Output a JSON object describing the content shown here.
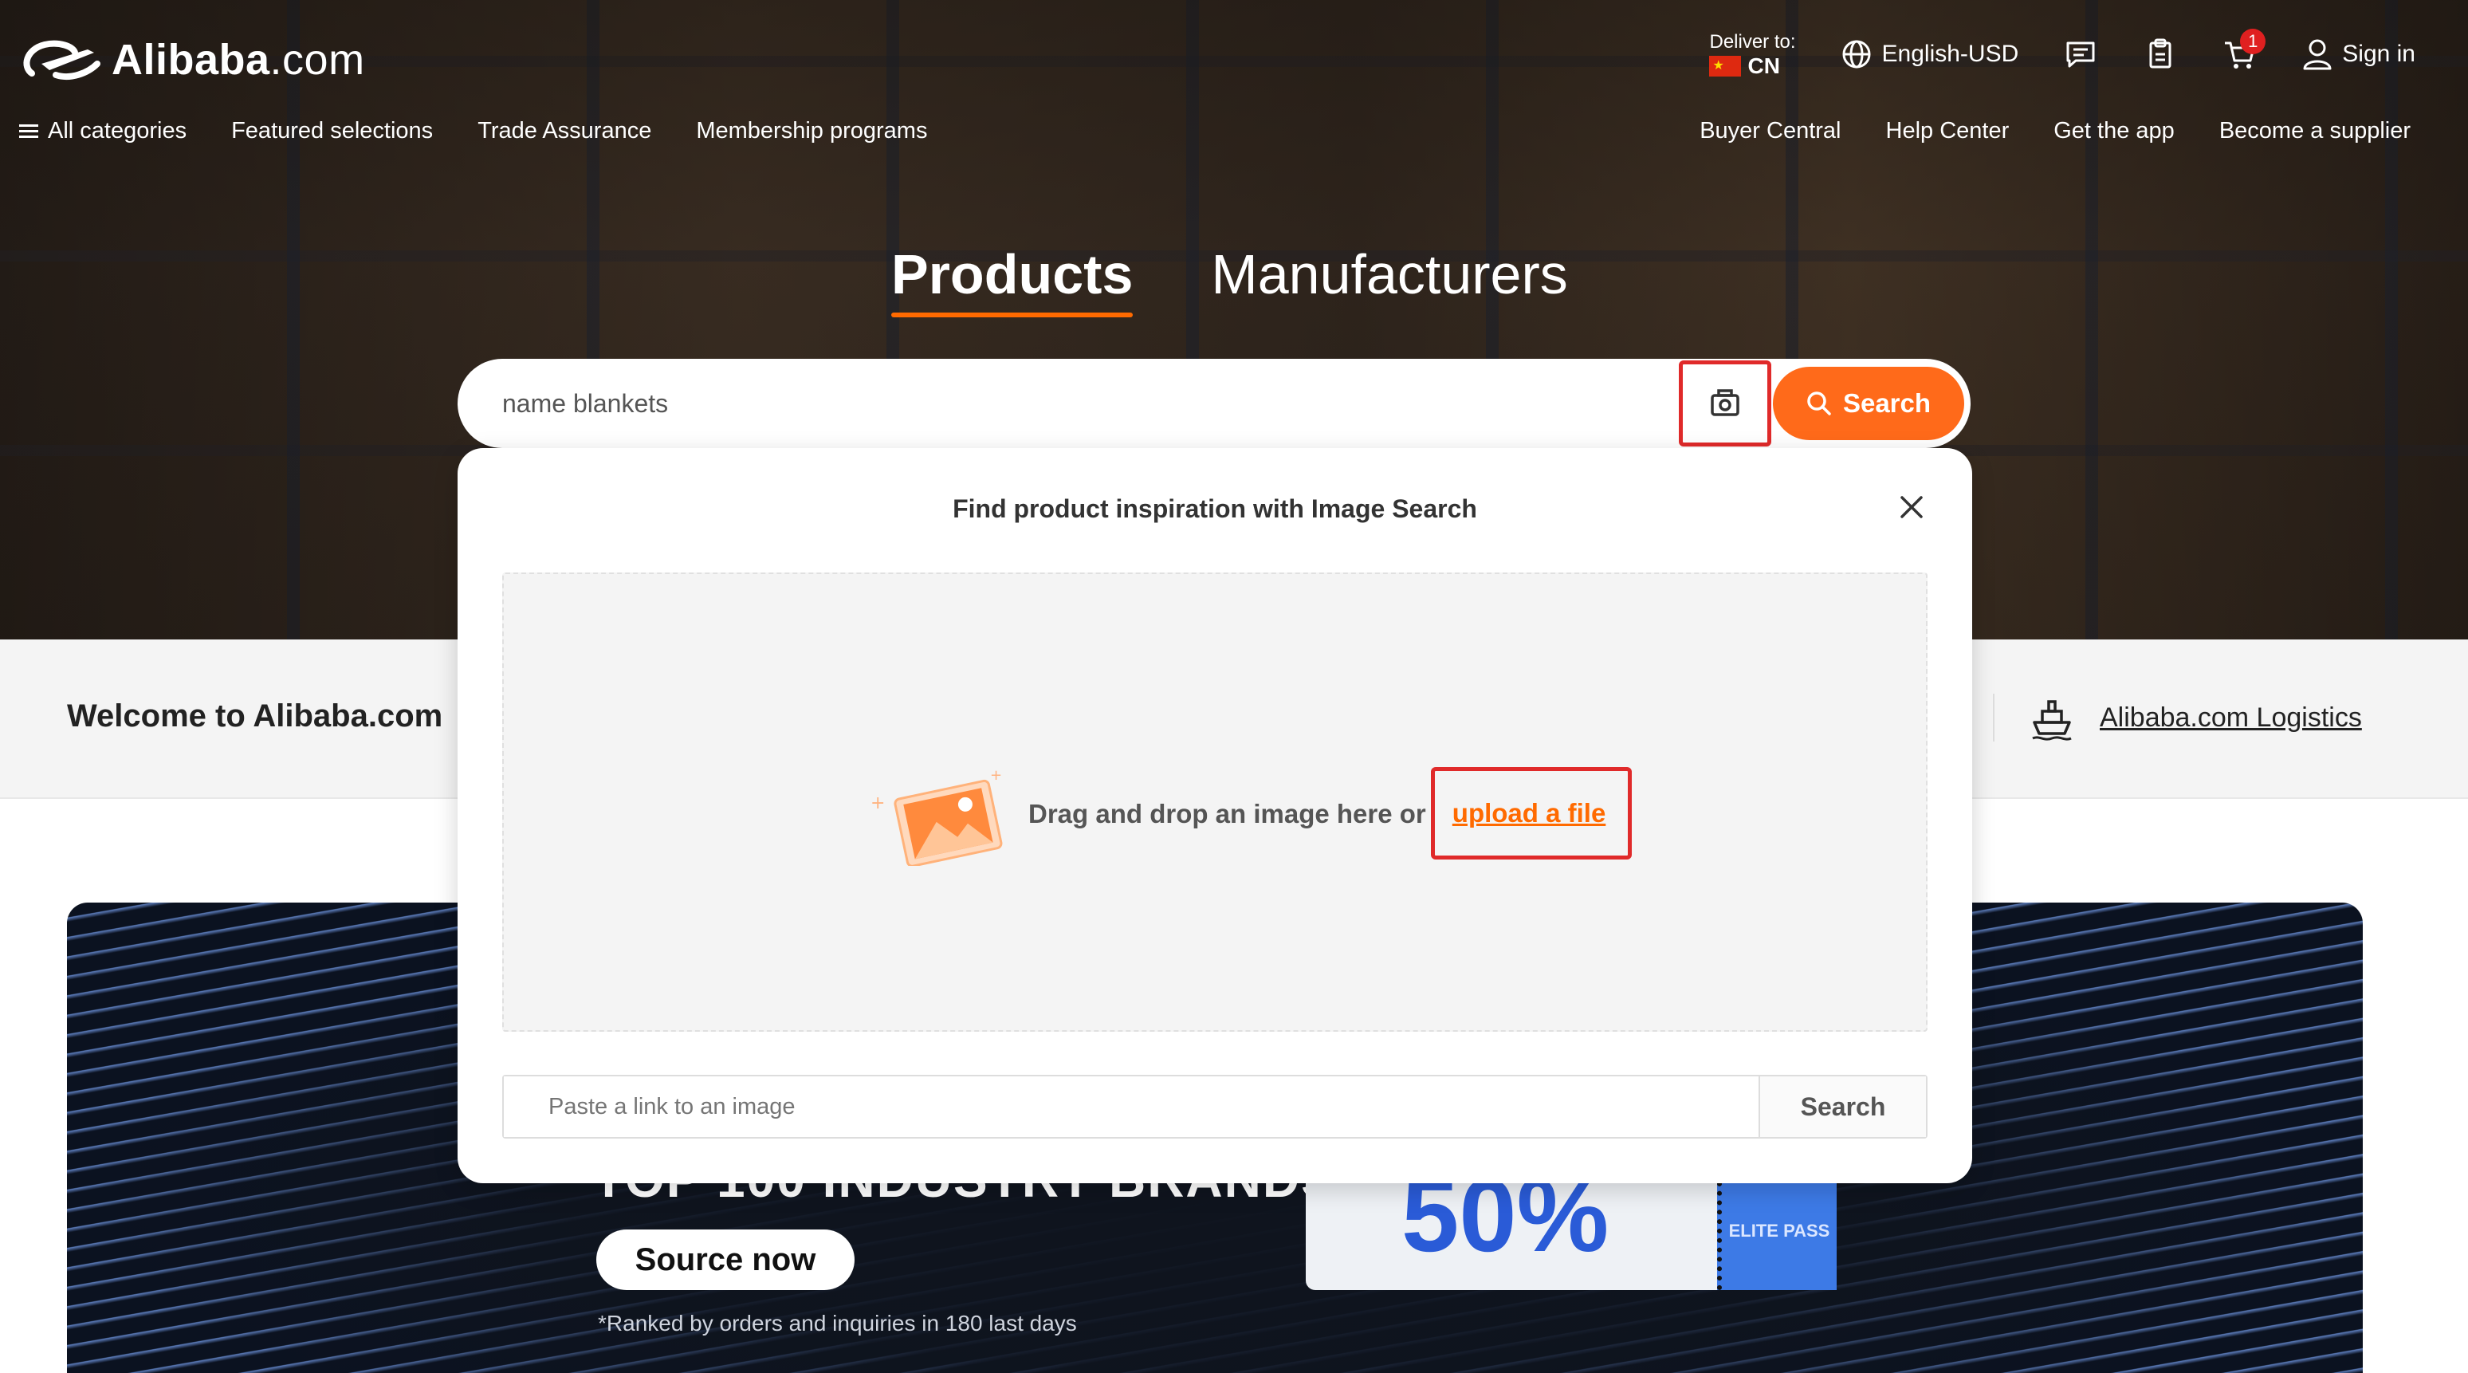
{
  "header": {
    "logo_text": "Alibaba",
    "logo_suffix": ".com",
    "deliver_label": "Deliver to:",
    "deliver_country": "CN",
    "language_currency": "English-USD",
    "cart_count": "1",
    "sign_in": "Sign in"
  },
  "nav": {
    "left": [
      "All categories",
      "Featured selections",
      "Trade Assurance",
      "Membership programs"
    ],
    "right": [
      "Buyer Central",
      "Help Center",
      "Get the app",
      "Become a supplier"
    ]
  },
  "search_tabs": {
    "active": "Products",
    "inactive": "Manufacturers"
  },
  "search": {
    "query": "name blankets",
    "button_label": "Search"
  },
  "welcome": {
    "title": "Welcome to Alibaba.com",
    "logistics_link": "Alibaba.com Logistics"
  },
  "banner": {
    "heading": "TOP 100 INDUSTRY BRANDS",
    "cta": "Source now",
    "footnote": "*Ranked by orders and inquiries in 180 last days",
    "ticket_value": "50%",
    "ticket_stub": "ELITE PASS"
  },
  "image_search_modal": {
    "title": "Find product inspiration with Image Search",
    "drop_text": "Drag and drop an image here or",
    "upload_link": "upload a file",
    "url_placeholder": "Paste a link to an image",
    "url_search_label": "Search"
  },
  "colors": {
    "brand_orange": "#ff6a00",
    "highlight_red": "#e02a2a",
    "tab_underline": "#ff6a00"
  }
}
